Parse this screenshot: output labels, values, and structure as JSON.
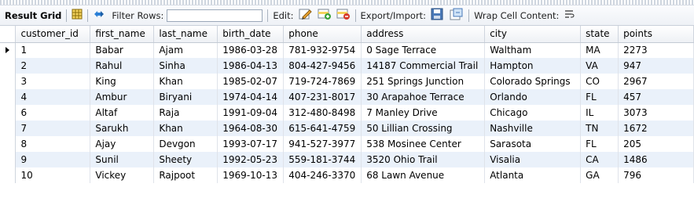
{
  "toolbar": {
    "result_grid_label": "Result Grid",
    "filter_rows_label": "Filter Rows:",
    "filter_rows_value": "",
    "edit_label": "Edit:",
    "export_import_label": "Export/Import:",
    "wrap_cell_label": "Wrap Cell Content:",
    "icons": [
      "grid-toggle-icon",
      "refresh-icon",
      "edit-pencil-icon",
      "add-row-icon",
      "delete-row-icon",
      "export-icon",
      "import-icon",
      "wrap-text-icon"
    ]
  },
  "grid": {
    "columns": [
      "customer_id",
      "first_name",
      "last_name",
      "birth_date",
      "phone",
      "address",
      "city",
      "state",
      "points"
    ],
    "rows": [
      [
        "1",
        "Babar",
        "Ajam",
        "1986-03-28",
        "781-932-9754",
        "0 Sage Terrace",
        "Waltham",
        "MA",
        "2273"
      ],
      [
        "2",
        "Rahul",
        "Sinha",
        "1986-04-13",
        "804-427-9456",
        "14187 Commercial Trail",
        "Hampton",
        "VA",
        "947"
      ],
      [
        "3",
        "King",
        "Khan",
        "1985-02-07",
        "719-724-7869",
        "251 Springs Junction",
        "Colorado Springs",
        "CO",
        "2967"
      ],
      [
        "4",
        "Ambur",
        "Biryani",
        "1974-04-14",
        "407-231-8017",
        "30 Arapahoe Terrace",
        "Orlando",
        "FL",
        "457"
      ],
      [
        "6",
        "Altaf",
        "Raja",
        "1991-09-04",
        "312-480-8498",
        "7 Manley Drive",
        "Chicago",
        "IL",
        "3073"
      ],
      [
        "7",
        "Sarukh",
        "Khan",
        "1964-08-30",
        "615-641-4759",
        "50 Lillian Crossing",
        "Nashville",
        "TN",
        "1672"
      ],
      [
        "8",
        "Ajay",
        "Devgon",
        "1993-07-17",
        "941-527-3977",
        "538 Mosinee Center",
        "Sarasota",
        "FL",
        "205"
      ],
      [
        "9",
        "Sunil",
        "Sheety",
        "1992-05-23",
        "559-181-3744",
        "3520 Ohio Trail",
        "Visalia",
        "CA",
        "1486"
      ],
      [
        "10",
        "Vickey",
        "Rajpoot",
        "1969-10-13",
        "404-246-3370",
        "68 Lawn Avenue",
        "Atlanta",
        "GA",
        "796"
      ]
    ],
    "selected_row_index": 0
  }
}
